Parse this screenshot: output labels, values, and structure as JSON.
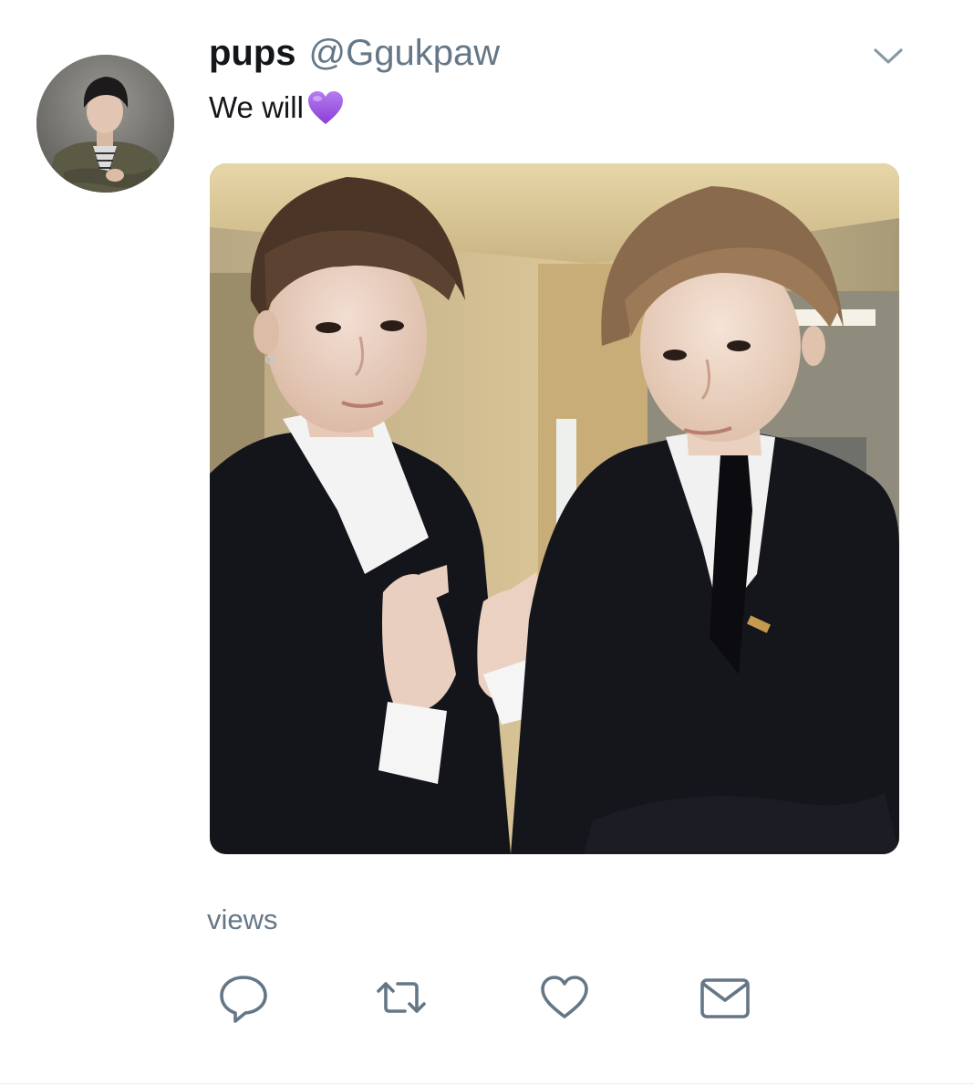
{
  "tweet": {
    "display_name": "pups",
    "handle": "@Ggukpaw",
    "text": "We will",
    "emoji": "purple-heart-emoji",
    "views_label": "views"
  },
  "icons": {
    "caret": "chevron-down-icon",
    "reply": "reply-icon",
    "retweet": "retweet-icon",
    "like": "heart-icon",
    "dm": "envelope-icon"
  },
  "colors": {
    "text_primary": "#14171a",
    "text_secondary": "#657786",
    "icon_gray": "#657786",
    "emoji_purple": "#9b4de0"
  }
}
